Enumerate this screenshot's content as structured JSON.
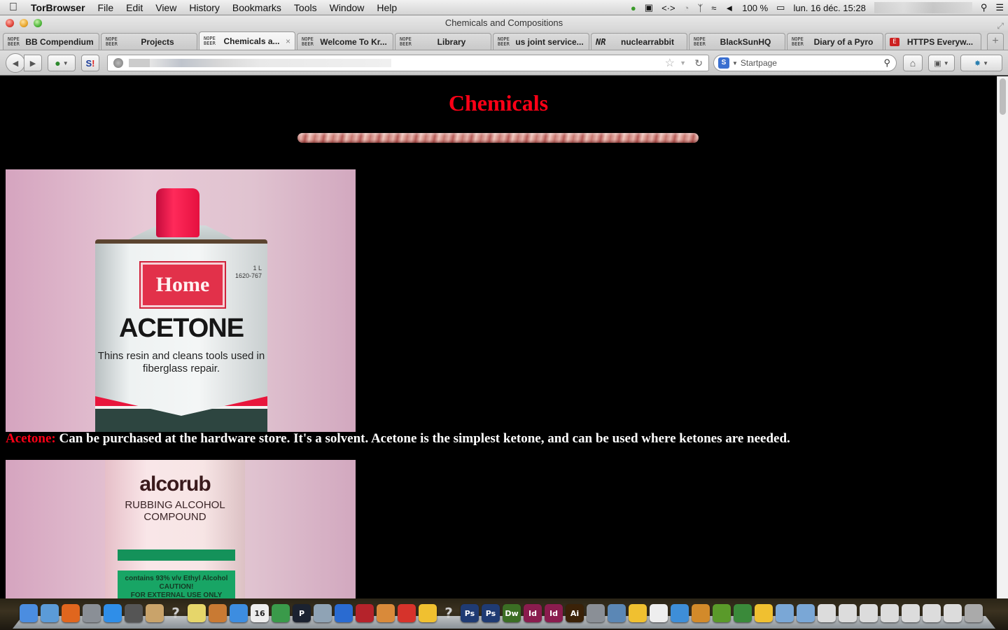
{
  "menubar": {
    "apple_icon": "apple-icon",
    "app_name": "TorBrowser",
    "items": [
      "File",
      "Edit",
      "View",
      "History",
      "Bookmarks",
      "Tools",
      "Window",
      "Help"
    ],
    "status": {
      "battery_percent": "100 %",
      "datetime": "lun. 16 déc.  15:28"
    }
  },
  "window": {
    "title": "Chemicals and Compositions"
  },
  "tabs": [
    {
      "label": "BB Compendium",
      "favicon": "NOPE\nBEER",
      "active": false
    },
    {
      "label": "Projects",
      "favicon": "NOPE\nBEER",
      "active": false
    },
    {
      "label": "Chemicals a...",
      "favicon": "NOPE\nBEER",
      "active": true
    },
    {
      "label": "Welcome To Kr...",
      "favicon": "NOPE\nBEER",
      "active": false
    },
    {
      "label": "Library",
      "favicon": "NOPE\nBEER",
      "active": false
    },
    {
      "label": "us joint service...",
      "favicon": "NOPE\nBEER",
      "active": false
    },
    {
      "label": "nuclearrabbit",
      "favicon": "NR",
      "active": false
    },
    {
      "label": "BlackSunHQ",
      "favicon": "NOPE\nBEER",
      "active": false
    },
    {
      "label": "Diary of a Pyro",
      "favicon": "NOPE\nBEER",
      "active": false
    },
    {
      "label": "HTTPS Everyw...",
      "favicon": "E",
      "active": false
    }
  ],
  "toolbar": {
    "new_tab": "+",
    "close_tab": "×",
    "search_placeholder": "Startpage",
    "url_value": ""
  },
  "page": {
    "heading": "Chemicals",
    "accent_color": "#ff0016",
    "items": [
      {
        "term": "Acetone:",
        "description": " Can be purchased at the hardware store. It's a solvent. Acetone is the simplest ketone, and can be used where ketones are needed.",
        "photo": {
          "brand": "Home",
          "product": "ACETONE",
          "tagline": "Thins resin and cleans tools used in fiberglass repair.",
          "volume": "1 L",
          "code": "1620-767"
        }
      },
      {
        "photo": {
          "brand": "alcorub",
          "product": "RUBBING ALCOHOL COMPOUND",
          "label_lines": [
            "contains 93% v/v Ethyl Alcohol",
            "CAUTION!",
            "FOR EXTERNAL USE ONLY"
          ]
        }
      }
    ]
  },
  "dock": {
    "apps": [
      "Finder",
      "Mail",
      "Firefox",
      "Launchpad",
      "App Store",
      "Photo Booth",
      "Contacts",
      "Unknown",
      "Stickies",
      "Keynote",
      "Dropbox",
      "Calendar",
      "Numbers",
      "Plex",
      "Preview",
      "iTunes",
      "Photo Slideshow",
      "Pages",
      "Clementine",
      "Cyberduck",
      "Unknown",
      "Photoshop",
      "Photoshop",
      "Dreamweaver",
      "InDesign",
      "InDesign",
      "Illustrator",
      "Automator",
      "iPhoto",
      "Cyberduck",
      "LibreOffice",
      "Safari",
      "Archive Utility",
      "Tor",
      "Vidalia",
      "Cyberduck",
      "Applications",
      "Documents",
      "Window",
      "Window",
      "Window",
      "Window",
      "Window",
      "Window",
      "Window",
      "Trash"
    ],
    "calendar_day": "16"
  }
}
